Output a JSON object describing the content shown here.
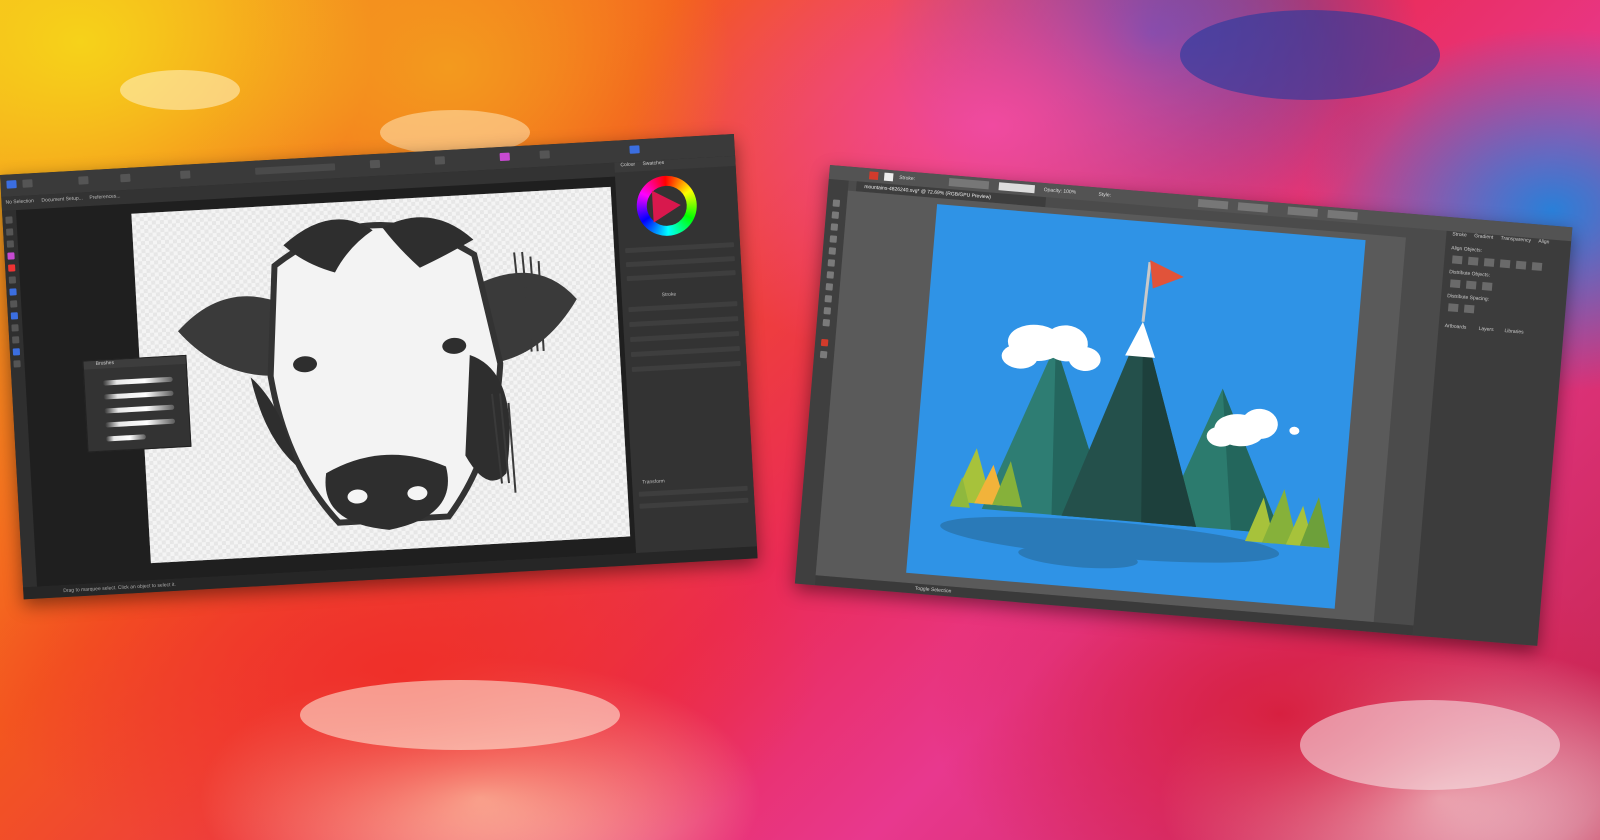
{
  "background": {
    "description_colors": [
      "#f6d21a",
      "#f3561f",
      "#ea2b55",
      "#3e4fb5",
      "#2a7fd8",
      "#ef2f29"
    ]
  },
  "left_window": {
    "context_items": [
      "No Selection",
      "Document Setup...",
      "Preferences..."
    ],
    "right_tabs": [
      "Colour",
      "Swatches"
    ],
    "brushes_title": "Brushes",
    "stroke_label": "Stroke",
    "transform_label": "Transform",
    "status_text": "Drag to marquee select. Click an object to select it."
  },
  "right_window": {
    "document_tab": "mountains-4826240.svg* @ 72.69% (RGB/GPU Preview)",
    "ctrl_stroke_label": "Stroke:",
    "ctrl_opacity": "Opacity: 100%",
    "ctrl_style": "Style:",
    "panel_tabs": [
      "Stroke",
      "Gradient",
      "Transparency",
      "Align"
    ],
    "align_objects": "Align Objects:",
    "distribute_objects": "Distribute Objects:",
    "distribute_spacing": "Distribute Spacing:",
    "bottom_tabs": [
      "Artboards",
      "Layers",
      "Libraries"
    ],
    "status_text": "Toggle Selection"
  }
}
